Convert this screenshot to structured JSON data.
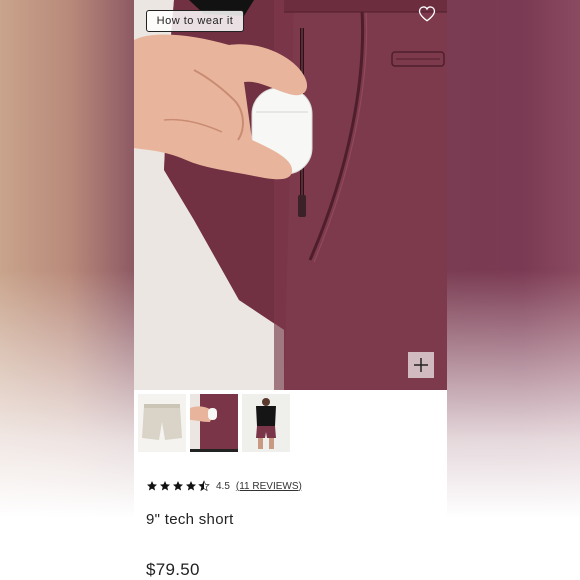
{
  "product": {
    "how_to_wear_label": "How to wear it",
    "rating_value": "4.5",
    "reviews_label": "(11 REVIEWS)",
    "stars": 4.5,
    "title": "9\" tech short",
    "price": "$79.50"
  },
  "icons": {
    "favorite": "heart-icon",
    "zoom": "plus-icon",
    "rating": "star-icon"
  },
  "colors": {
    "short_burgundy": "#7a3548",
    "short_stone": "#d9d4c7",
    "text": "#222222"
  }
}
